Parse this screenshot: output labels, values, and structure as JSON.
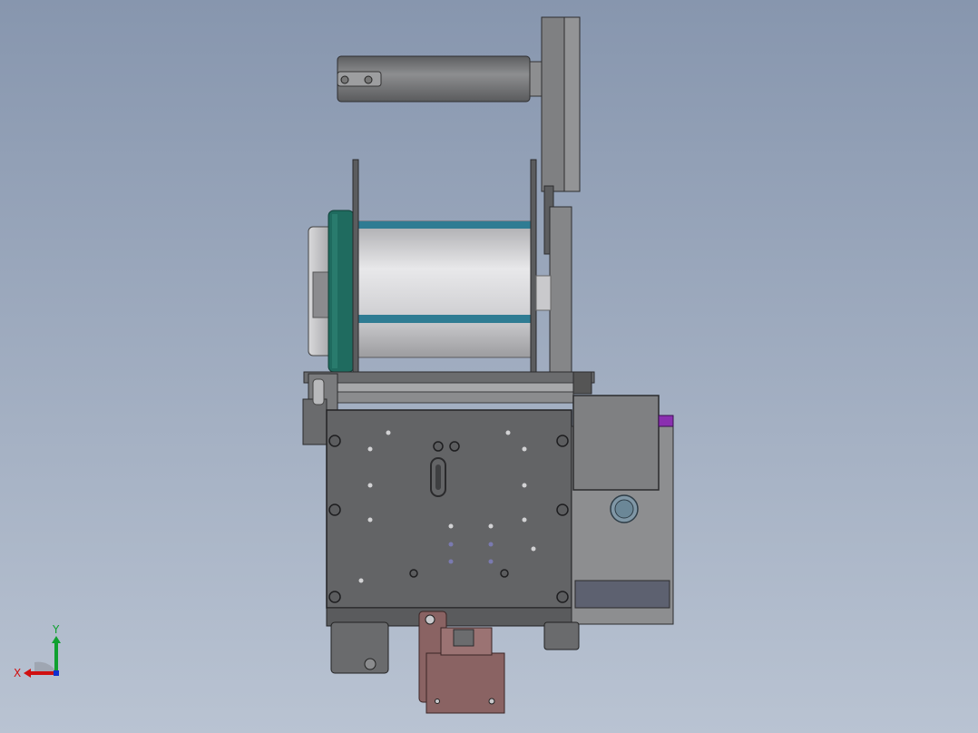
{
  "window": {
    "title": ""
  },
  "viewport": {
    "background_top": "#8796ae",
    "background_bottom": "#b9c3d2"
  },
  "model": {
    "colors": {
      "body_dark": "#636466",
      "body_mid": "#8a8b8d",
      "body_light": "#b9babd",
      "roller_light": "#e3e3e5",
      "flange_teal": "#1f6b5f",
      "band_teal": "#2f7c93",
      "bracket_rust": "#8a6363",
      "label_line": "#c21414",
      "connector_purple": "#8a2fb0"
    }
  },
  "triad": {
    "x_label": "X",
    "y_label": "Y",
    "x_color": "#d01010",
    "y_color": "#10a030",
    "z_color": "#1030d0"
  }
}
